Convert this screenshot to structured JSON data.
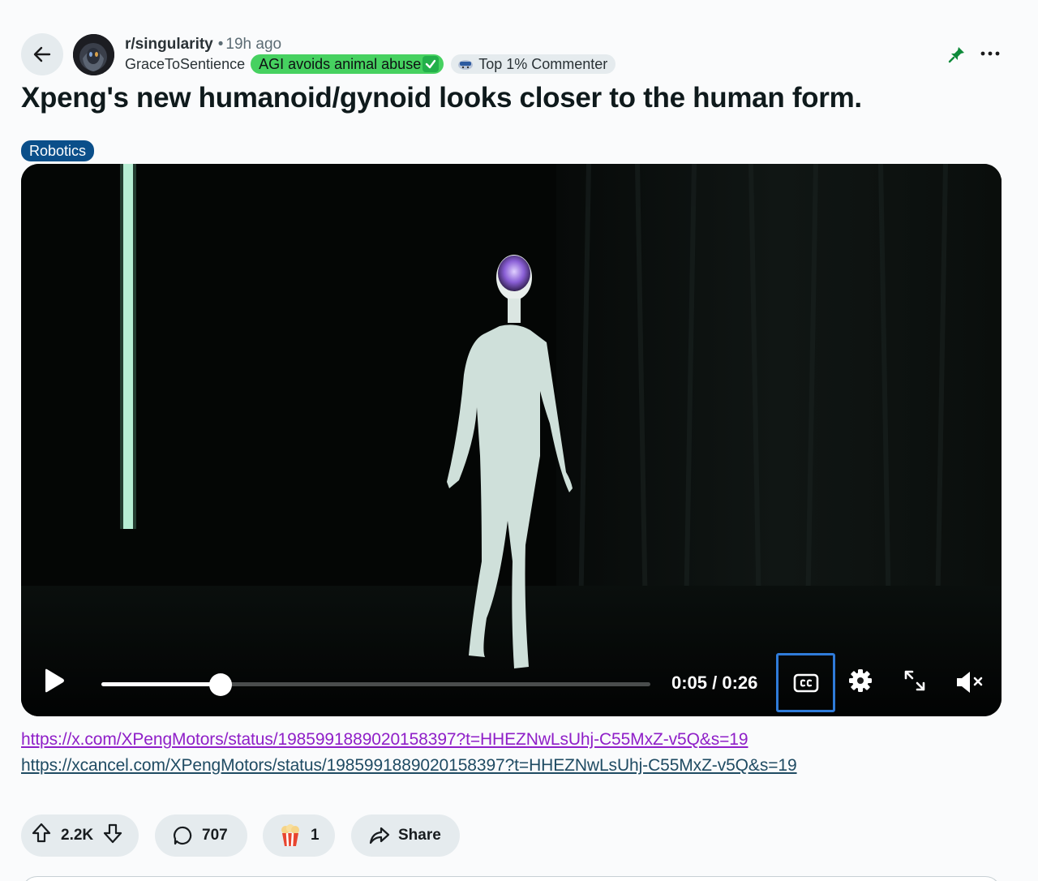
{
  "post": {
    "subreddit": "r/singularity",
    "separator": "•",
    "time_ago": "19h ago",
    "author": "GraceToSentience",
    "author_flair": "AGI avoids animal abuse",
    "badge": "Top 1% Commenter",
    "title": "Xpeng's new humanoid/gynoid looks closer to the human form.",
    "tag": "Robotics"
  },
  "video": {
    "current_time": "0:05",
    "duration": "0:26",
    "time_display": "0:05 / 0:26",
    "progress_fraction": 0.217,
    "cc_label": "CC"
  },
  "links": [
    "https://x.com/XPengMotors/status/1985991889020158397?t=HHEZNwLsUhj-C55MxZ-v5Q&s=19",
    "https://xcancel.com/XPengMotors/status/1985991889020158397?t=HHEZNwLsUhj-C55MxZ-v5Q&s=19"
  ],
  "actions": {
    "votes": "2.2K",
    "comments": "707",
    "awards": "1",
    "share": "Share"
  },
  "colors": {
    "flair_green": "#46d160",
    "tag_blue": "#0b4f8a",
    "link_visited": "#8f1fc8",
    "link": "#1f4b63",
    "pin_green": "#0e8a3a",
    "cc_focus": "#2f7bd9"
  },
  "icons": {
    "back": "arrow-left-icon",
    "pin": "pin-icon",
    "more": "more-horizontal-icon",
    "play": "play-icon",
    "cc": "closed-captions-icon",
    "settings": "gear-icon",
    "expand": "expand-icon",
    "mute": "muted-speaker-icon",
    "upvote": "upvote-arrow-icon",
    "downvote": "downvote-arrow-icon",
    "comment": "comment-bubble-icon",
    "award": "popcorn-award-icon",
    "share": "share-arrow-icon"
  }
}
